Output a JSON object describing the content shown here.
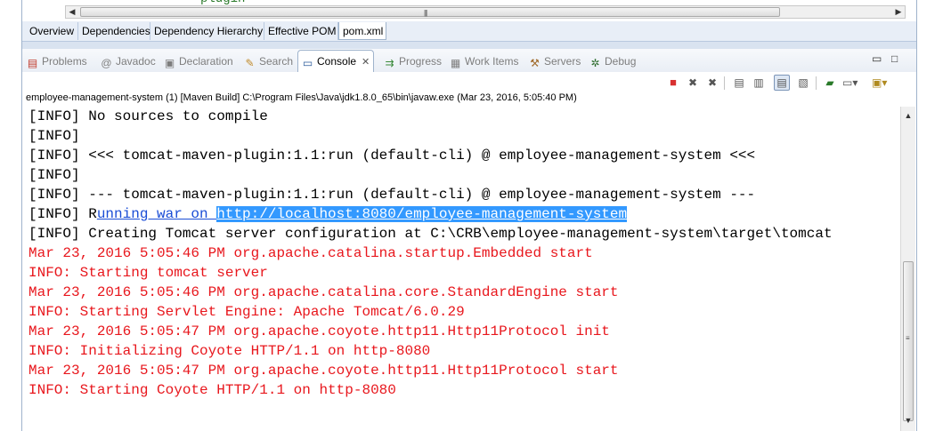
{
  "editor": {
    "partial_text": "plugin"
  },
  "pom_tabs": [
    {
      "label": "Overview"
    },
    {
      "label": "Dependencies"
    },
    {
      "label": "Dependency Hierarchy"
    },
    {
      "label": "Effective POM"
    },
    {
      "label": "pom.xml",
      "active": true
    }
  ],
  "view_tabs": [
    {
      "label": "Problems",
      "icon": "problems-icon"
    },
    {
      "label": "Javadoc",
      "icon": "javadoc-icon"
    },
    {
      "label": "Declaration",
      "icon": "declaration-icon"
    },
    {
      "label": "Search",
      "icon": "search-icon"
    },
    {
      "label": "Console",
      "icon": "console-icon",
      "active": true
    },
    {
      "label": "Progress",
      "icon": "progress-icon"
    },
    {
      "label": "Work Items",
      "icon": "work-items-icon"
    },
    {
      "label": "Servers",
      "icon": "servers-icon"
    },
    {
      "label": "Debug",
      "icon": "debug-icon"
    }
  ],
  "console": {
    "launch_path": "employee-management-system (1) [Maven Build] C:\\Program Files\\Java\\jdk1.8.0_65\\bin\\javaw.exe (Mar 23, 2016, 5:05:40 PM)",
    "lines": [
      "[INFO] No sources to compile",
      "[INFO]",
      "[INFO] <<< tomcat-maven-plugin:1.1:run (default-cli) @ employee-management-system <<<",
      "[INFO]",
      "[INFO] --- tomcat-maven-plugin:1.1:run (default-cli) @ employee-management-system ---",
      "[INFO] R",
      "[INFO] Creating Tomcat server configuration at C:\\CRB\\employee-management-system\\target\\tomcat",
      "Mar 23, 2016 5:05:46 PM org.apache.catalina.startup.Embedded start",
      "INFO: Starting tomcat server",
      "Mar 23, 2016 5:05:46 PM org.apache.catalina.core.StandardEngine start",
      "INFO: Starting Servlet Engine: Apache Tomcat/6.0.29",
      "Mar 23, 2016 5:05:47 PM org.apache.coyote.http11.Http11Protocol init",
      "INFO: Initializing Coyote HTTP/1.1 on http-8080",
      "Mar 23, 2016 5:05:47 PM org.apache.coyote.http11.Http11Protocol start",
      "INFO: Starting Coyote HTTP/1.1 on http-8080"
    ],
    "link_prefix": "unning war on ",
    "link_url": "http://localhost:8080/employee-management-system"
  },
  "colors": {
    "stderr": "#e8171d",
    "selection": "#3399ff",
    "link": "#1a4dd6",
    "tab_bar": "#e8eef7"
  }
}
